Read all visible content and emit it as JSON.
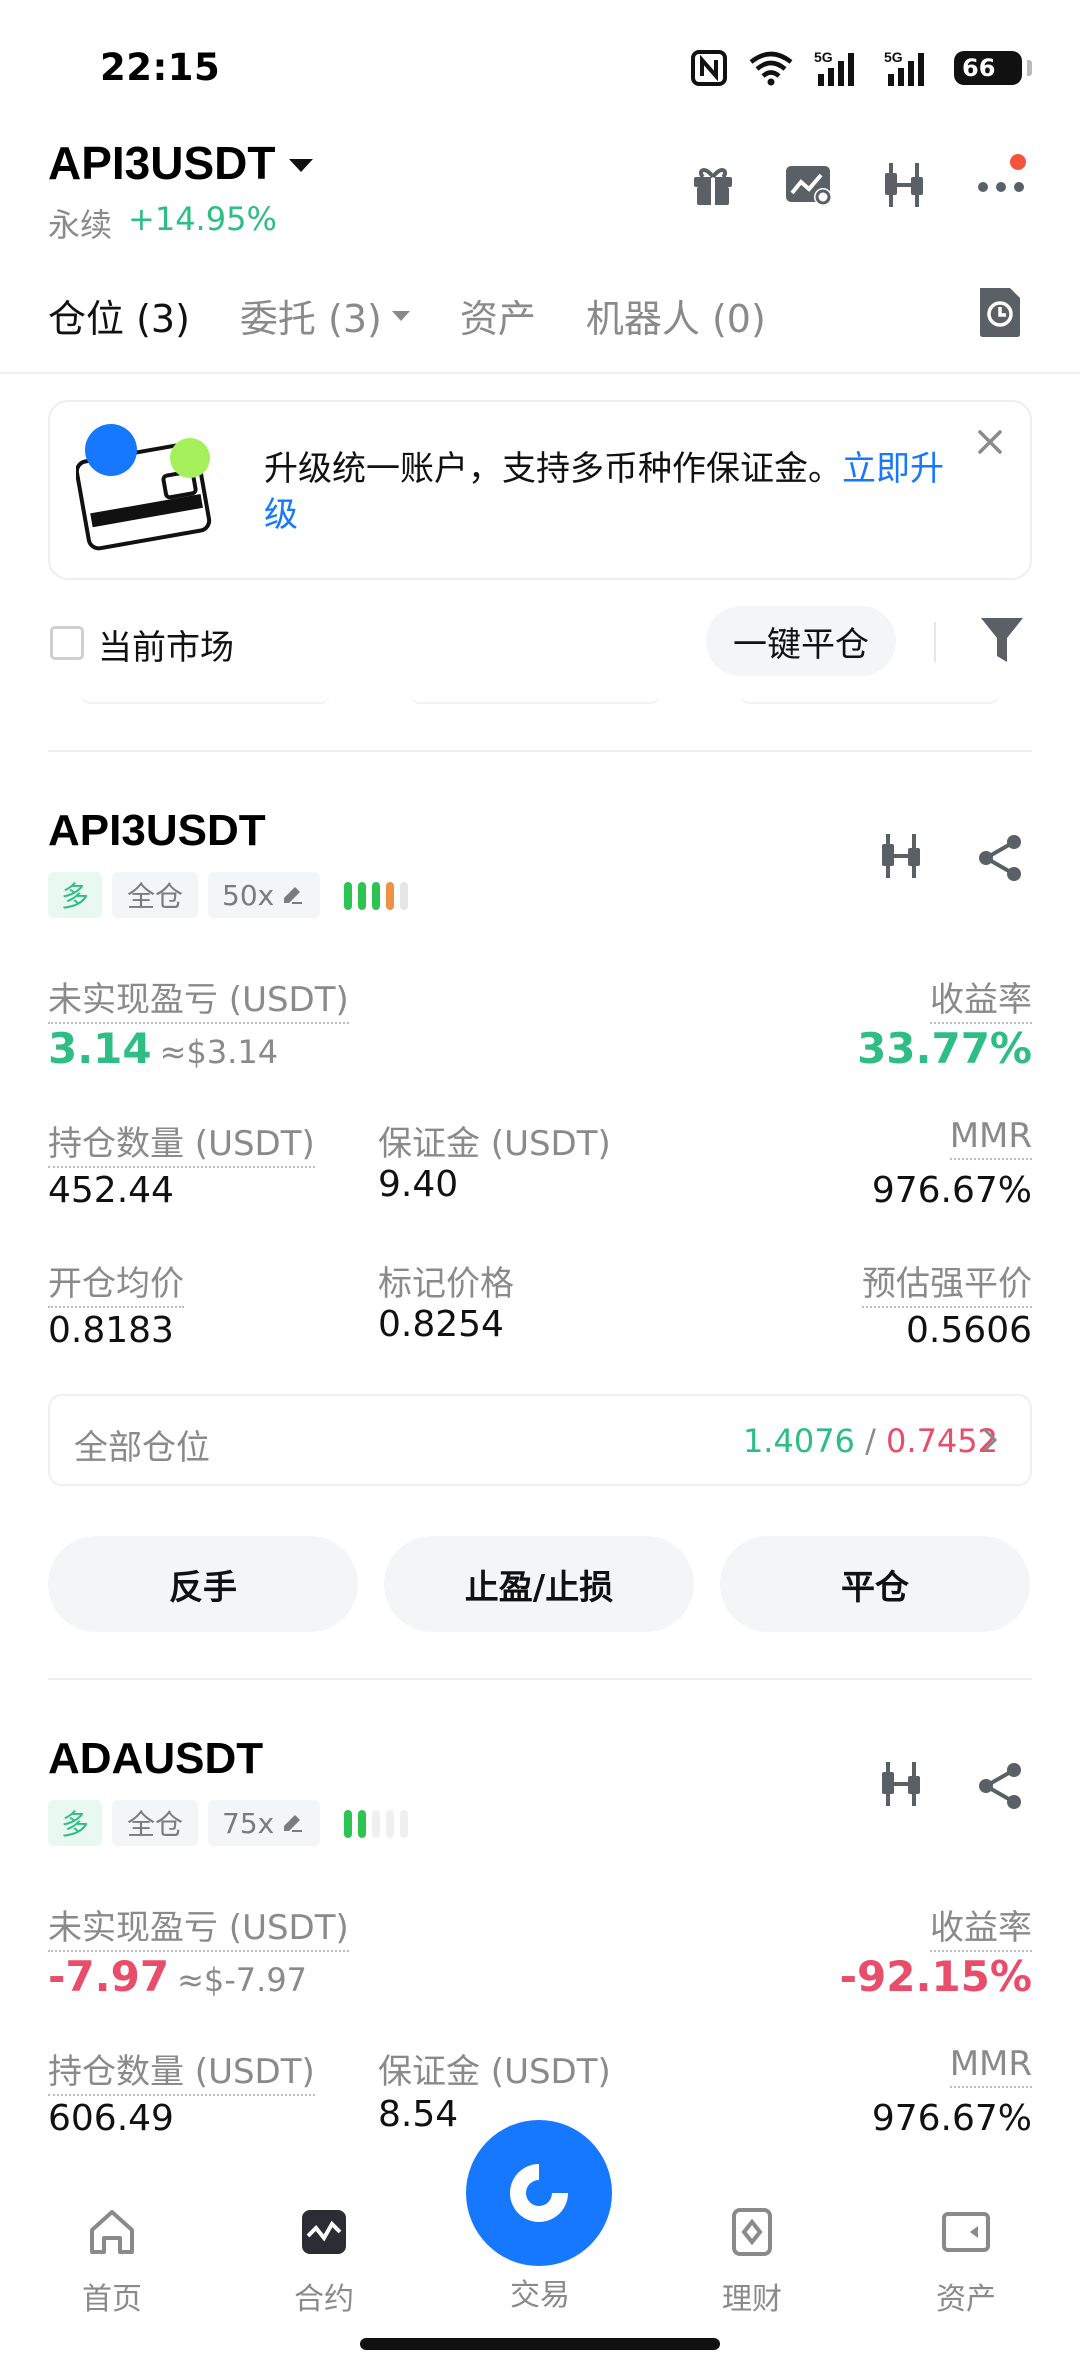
{
  "status_bar": {
    "time": "22:15",
    "network": "5G",
    "network2": "5G",
    "battery": "66"
  },
  "header": {
    "symbol": "API3USDT",
    "type": "永续",
    "change": "+14.95%",
    "icons": [
      "gift-icon",
      "chart-settings-icon",
      "candlestick-icon",
      "more-icon"
    ]
  },
  "tabs": [
    {
      "label": "仓位 (3)"
    },
    {
      "label": "委托 (3)"
    },
    {
      "label": "资产"
    },
    {
      "label": "机器人 (0)"
    }
  ],
  "banner": {
    "text": "升级统一账户，支持多币种作保证金。",
    "link": "立即升级"
  },
  "filter": {
    "current_market": "当前市场",
    "close_all": "一键平仓"
  },
  "positions": [
    {
      "symbol": "API3USDT",
      "side": "多",
      "margin_mode": "全仓",
      "leverage": "50x",
      "risk_level": 4,
      "unrealized_pnl_label": "未实现盈亏 (USDT)",
      "unrealized_pnl": "3.14",
      "unrealized_pnl_usd": "≈$3.14",
      "roe_label": "收益率",
      "roe": "33.77%",
      "size_label": "持仓数量 (USDT)",
      "size": "452.44",
      "margin_label": "保证金 (USDT)",
      "margin": "9.40",
      "mmr_label": "MMR",
      "mmr": "976.67%",
      "entry_label": "开仓均价",
      "entry": "0.8183",
      "mark_label": "标记价格",
      "mark": "0.8254",
      "liq_label": "预估强平价",
      "liq": "0.5606",
      "all_positions_label": "全部仓位",
      "all_pos_green": "1.4076",
      "all_pos_sep": "/",
      "all_pos_red": "0.7452",
      "btn_reverse": "反手",
      "btn_tpsl": "止盈/止损",
      "btn_close": "平仓"
    },
    {
      "symbol": "ADAUSDT",
      "side": "多",
      "margin_mode": "全仓",
      "leverage": "75x",
      "risk_level": 2,
      "unrealized_pnl_label": "未实现盈亏 (USDT)",
      "unrealized_pnl": "-7.97",
      "unrealized_pnl_usd": "≈$-7.97",
      "roe_label": "收益率",
      "roe": "-92.15%",
      "size_label": "持仓数量 (USDT)",
      "size": "606.49",
      "margin_label": "保证金 (USDT)",
      "margin": "8.54",
      "mmr_label": "MMR",
      "mmr": "976.67%"
    }
  ],
  "bottom_nav": [
    {
      "label": "首页",
      "icon": "home-icon"
    },
    {
      "label": "合约",
      "icon": "futures-icon"
    },
    {
      "label": "交易",
      "icon": "trade-icon"
    },
    {
      "label": "理财",
      "icon": "earn-icon"
    },
    {
      "label": "资产",
      "icon": "wallet-icon"
    }
  ],
  "colors": {
    "green": "#2ebd85",
    "red": "#e84d6a",
    "orange": "#f19144",
    "blue": "#1677ff"
  }
}
